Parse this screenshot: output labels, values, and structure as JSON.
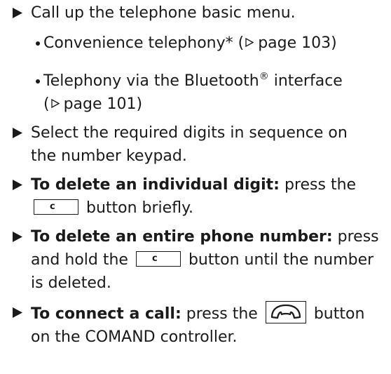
{
  "steps": [
    {
      "text_plain": "Call up the telephone basic menu."
    },
    {
      "text_plain_line1": "Select the required digits in sequence on",
      "text_plain_line2": "the number keypad."
    },
    {
      "bold": "To delete an individual digit:",
      "text_a": " press the",
      "key_label": "c",
      "text_b": " button briefly."
    },
    {
      "bold": "To delete an entire phone number:",
      "text_a": " press",
      "text_b": "and hold the ",
      "key_label": "c",
      "text_c": " button until the number",
      "text_d": "is deleted."
    },
    {
      "bold": "To connect a call:",
      "text_a": " press the ",
      "key_icon": "phone-handset-icon",
      "text_b": " button",
      "text_c": "on the COMAND controller."
    }
  ],
  "sub_items": [
    {
      "text": "Convenience telephony* (",
      "page_ref": "page 103)"
    },
    {
      "text_line1": "Telephony via the Bluetooth",
      "sup": "®",
      "text_line1_end": " interface",
      "page_ref": "page 101)",
      "ref_open": "("
    }
  ],
  "icons": {
    "step_marker": "right-triangle-bullet-icon",
    "ref_marker": "right-triangle-outline-icon"
  },
  "colors": {
    "text": "#1a1a1a",
    "background": "#ffffff"
  }
}
